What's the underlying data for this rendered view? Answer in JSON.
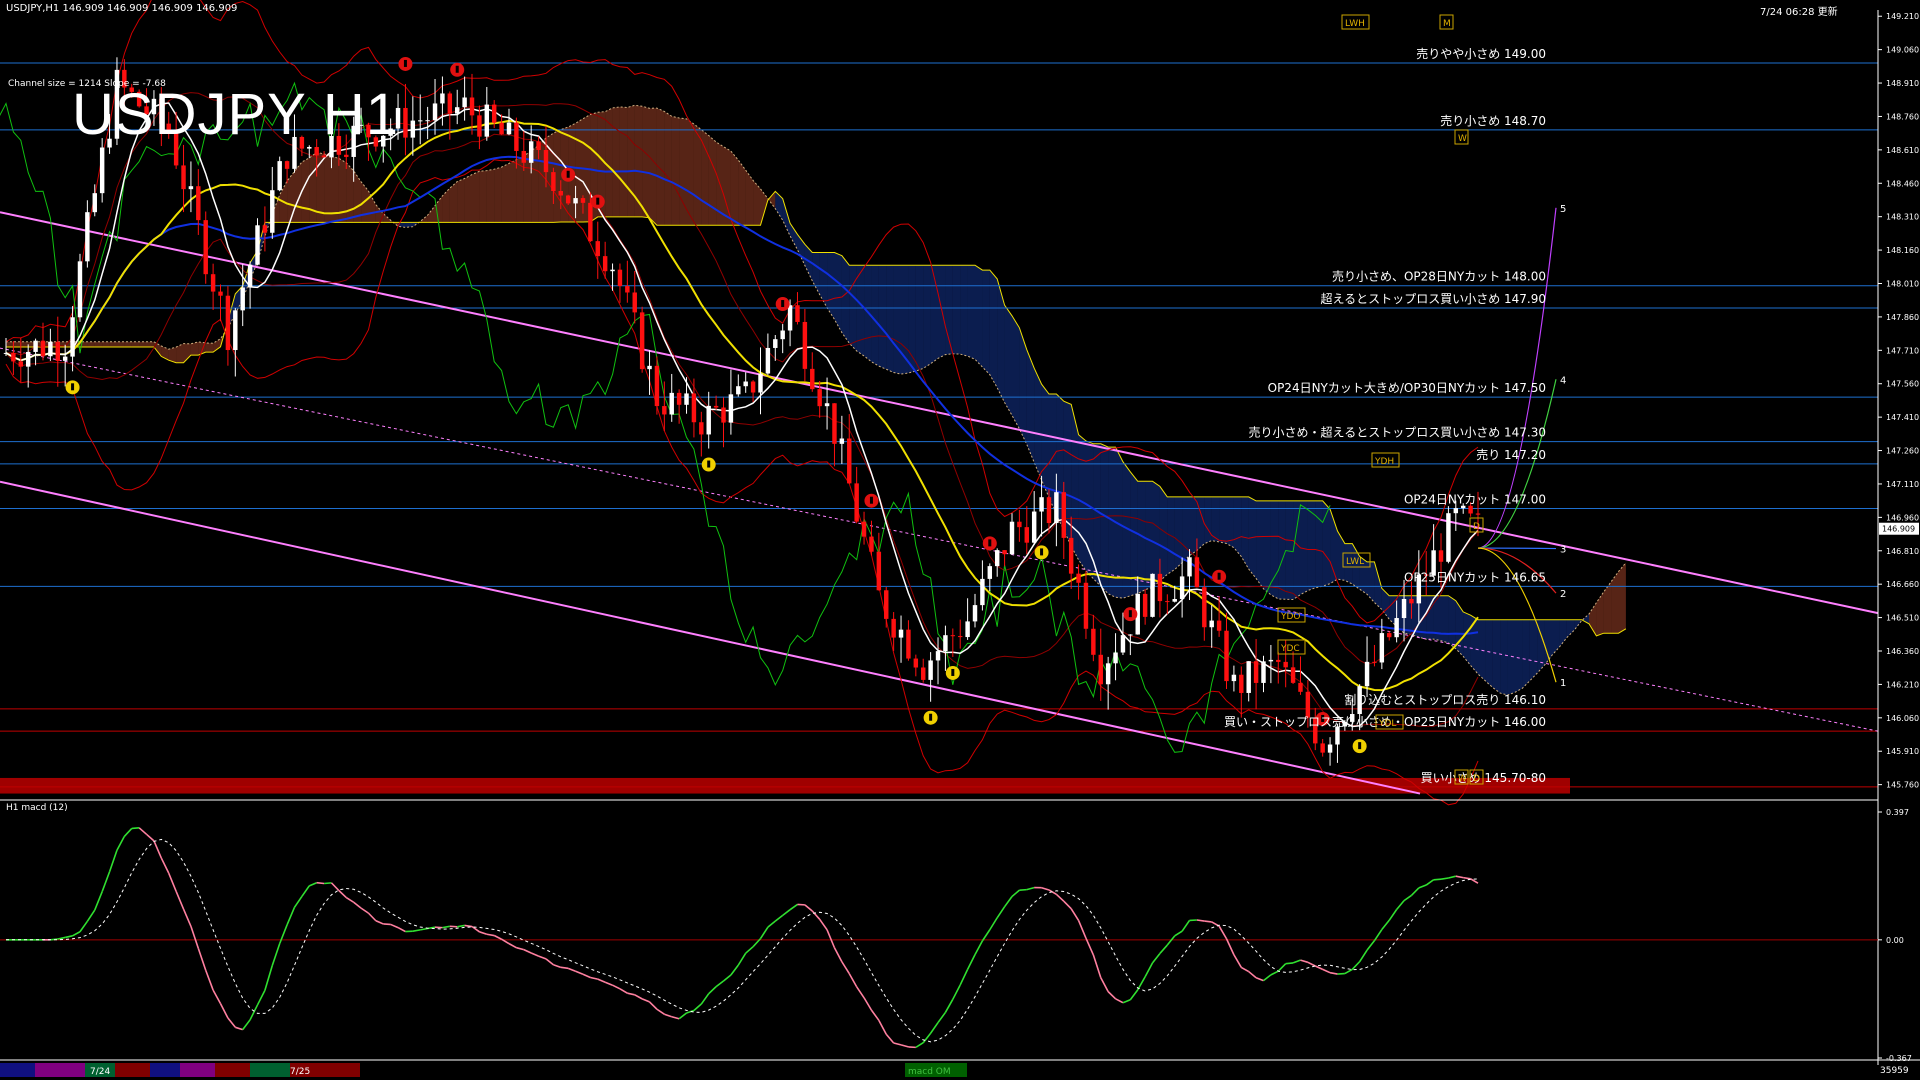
{
  "header": {
    "symbol_info": "USDJPY,H1  146.909 146.909 146.909 146.909",
    "timestamp": "7/24 06:28 更新",
    "channel_info": "Channel size = 1214 Slope = -7.68",
    "big_title": "USDJPY H1",
    "indicator_label": "H1  macd (12)",
    "current_price": "146.909",
    "bottom_right": "35959"
  },
  "colors": {
    "background": "#000000",
    "axis": "#ffffff",
    "level_line": "#1e6fd0",
    "red_level": "#c00000",
    "channel": "#ff80ff",
    "bull_candle": "#ffffff",
    "bear_candle": "#ff1010",
    "ma_fast": "#ffffff",
    "ma_mid": "#f0e000",
    "ma_slow": "#1030e0",
    "bollinger": "#d00000",
    "chikou": "#10c010",
    "kumo_blue": "#1840b0",
    "kumo_red": "#c05030",
    "macd_up": "#30e030",
    "macd_down": "#ff80a0",
    "signal": "#ffffff"
  },
  "chart_data": [
    {
      "type": "line",
      "name": "price",
      "ylim": [
        145.7,
        149.22
      ],
      "y_ticks": [
        "149.210",
        "149.060",
        "148.910",
        "148.760",
        "148.610",
        "148.460",
        "148.310",
        "148.160",
        "148.010",
        "147.860",
        "147.710",
        "147.560",
        "147.410",
        "147.260",
        "147.110",
        "146.960",
        "146.810",
        "146.660",
        "146.510",
        "146.360",
        "146.210",
        "146.060",
        "145.910",
        "145.760"
      ],
      "levels": [
        {
          "price": 149.0,
          "label": "売りやや小さめ 149.00",
          "color": "blue"
        },
        {
          "price": 148.7,
          "label": "売り小さめ 148.70",
          "color": "blue"
        },
        {
          "price": 148.0,
          "label": "売り小さめ、OP28日NYカット 148.00",
          "color": "blue"
        },
        {
          "price": 147.9,
          "label": "超えるとストップロス買い小さめ 147.90",
          "color": "blue"
        },
        {
          "price": 147.5,
          "label": "OP24日NYカット大きめ/OP30日NYカット 147.50",
          "color": "blue"
        },
        {
          "price": 147.3,
          "label": "売り小さめ・超えるとストップロス買い小さめ 147.30",
          "color": "blue"
        },
        {
          "price": 147.2,
          "label": "売り 147.20",
          "color": "blue"
        },
        {
          "price": 147.0,
          "label": "OP24日NYカット 147.00",
          "color": "blue"
        },
        {
          "price": 146.65,
          "label": "OP25日NYカット 146.65",
          "color": "blue"
        },
        {
          "price": 146.1,
          "label": "割り込むとストップロス売り 146.10",
          "color": "red"
        },
        {
          "price": 146.0,
          "label": "買い・ストップロス売り小さめ・OP25日NYカット 146.00",
          "color": "red"
        },
        {
          "price": 145.75,
          "label": "買い小さめ 145.70-80",
          "color": "red"
        }
      ],
      "projection_labels": [
        "5",
        "4",
        "3",
        "2",
        "1"
      ],
      "tags": [
        "LWH",
        "M",
        "W",
        "YDH",
        "LWL",
        "YDO",
        "YDC",
        "YDL",
        "W",
        "D",
        "D"
      ]
    },
    {
      "type": "line",
      "name": "macd (12)",
      "ylim": [
        -0.367,
        0.397
      ],
      "y_ticks": [
        "0.397",
        "0.00",
        "-0.367"
      ],
      "x_tick_labels": [
        "7/24",
        "7/25"
      ],
      "bottom_label": "macd OM"
    }
  ]
}
